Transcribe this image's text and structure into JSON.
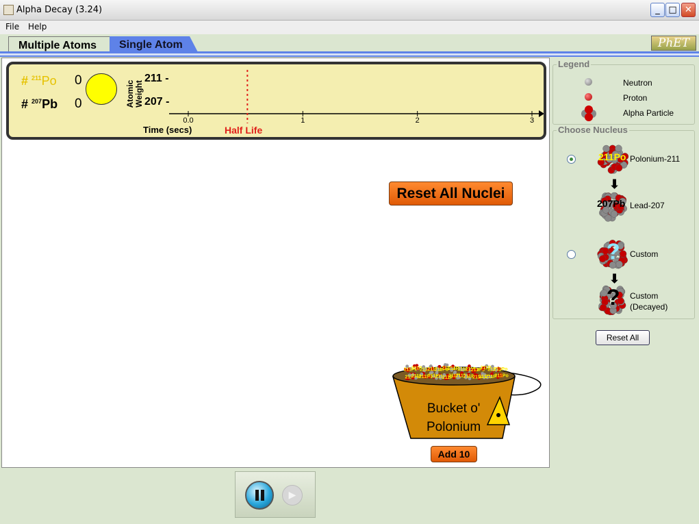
{
  "window": {
    "title": "Alpha Decay (3.24)",
    "minimize": "_",
    "maximize": "□",
    "close": "✕"
  },
  "menu": {
    "file": "File",
    "help": "Help"
  },
  "tabs": [
    {
      "label": "Multiple Atoms"
    },
    {
      "label": "Single Atom"
    }
  ],
  "logo": {
    "text": "PhET"
  },
  "chart": {
    "po_label": {
      "hash": "#",
      "mass": "211",
      "symbol": "Po"
    },
    "pb_label": {
      "hash": "#",
      "mass": "207",
      "symbol": "Pb"
    },
    "po_count": "0",
    "pb_count": "0",
    "atomic_weight_label": "Atomic Weight",
    "weight_211": "211 -",
    "weight_207": "207 -",
    "time_label": "Time (secs)",
    "half_life_label": "Half Life",
    "ticks": [
      "0.0",
      "1",
      "2",
      "3"
    ]
  },
  "chart_data": {
    "type": "scatter",
    "xlabel": "Time (secs)",
    "ylabel": "Atomic Weight",
    "x_ticks": [
      "0.0",
      "1",
      "2",
      "3"
    ],
    "y_ticks": [
      "211 -",
      "207 -"
    ],
    "xlim": [
      0,
      3
    ],
    "half_life": 0.516,
    "annotations": [
      "Half Life"
    ],
    "series": []
  },
  "main": {
    "reset_nuclei": "Reset All Nuclei",
    "add10": "Add 10",
    "bucket_line1": "Bucket o'",
    "bucket_line2": "Polonium",
    "bucket_atom_text": "211Po"
  },
  "legend": {
    "title": "Legend",
    "items": [
      {
        "label": "Neutron"
      },
      {
        "label": "Proton"
      },
      {
        "label": "Alpha Particle"
      }
    ]
  },
  "nucleus": {
    "title": "Choose Nucleus",
    "po_label": "Polonium-211",
    "pb_label": "Lead-207",
    "custom_label": "Custom",
    "custom_decayed_line1": "Custom",
    "custom_decayed_line2": "(Decayed)",
    "po_text": "211Po",
    "pb_text": "207Pb",
    "question": "?"
  },
  "side": {
    "reset_all": "Reset All"
  },
  "colors": {
    "accent_blue": "#5e82e8",
    "button_orange": "#f06a10",
    "chart_bg": "#f4eeb0",
    "half_life_red": "#e0201a",
    "panel_green": "#dbe6d0"
  }
}
